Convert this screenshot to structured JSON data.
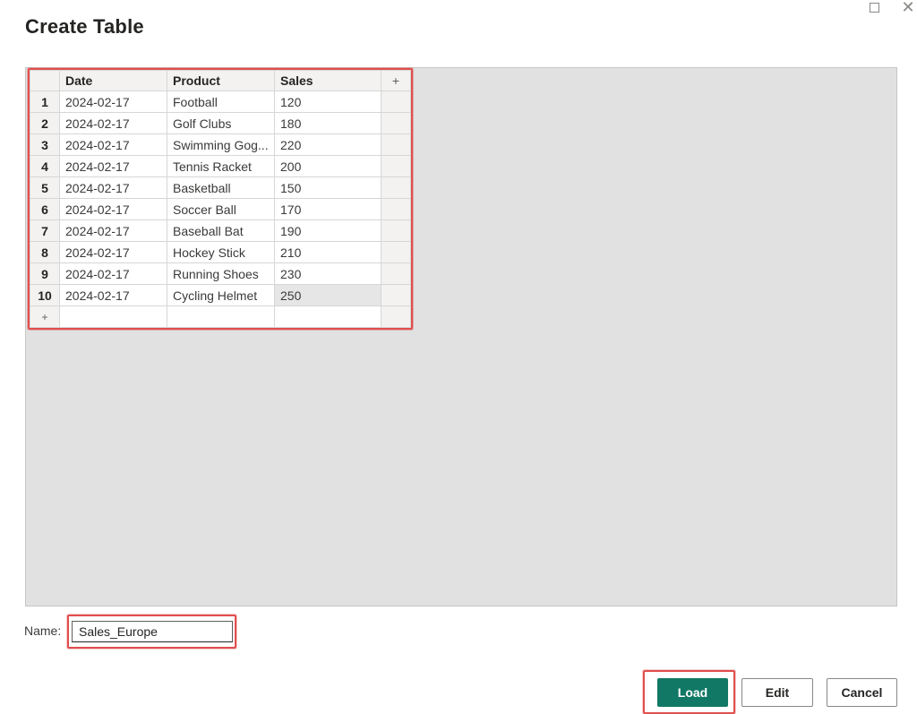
{
  "dialog": {
    "title": "Create Table",
    "maximize_icon": "maximize-icon",
    "close_icon": "close-icon",
    "close_glyph": "✕"
  },
  "table": {
    "columns": [
      "Date",
      "Product",
      "Sales"
    ],
    "add_column_label": "+",
    "add_row_label": "+",
    "rows": [
      {
        "num": "1",
        "date": "2024-02-17",
        "product": "Football",
        "sales": "120"
      },
      {
        "num": "2",
        "date": "2024-02-17",
        "product": "Golf Clubs",
        "sales": "180"
      },
      {
        "num": "3",
        "date": "2024-02-17",
        "product": "Swimming Gog...",
        "sales": "220"
      },
      {
        "num": "4",
        "date": "2024-02-17",
        "product": "Tennis Racket",
        "sales": "200"
      },
      {
        "num": "5",
        "date": "2024-02-17",
        "product": "Basketball",
        "sales": "150"
      },
      {
        "num": "6",
        "date": "2024-02-17",
        "product": "Soccer Ball",
        "sales": "170"
      },
      {
        "num": "7",
        "date": "2024-02-17",
        "product": "Baseball Bat",
        "sales": "190"
      },
      {
        "num": "8",
        "date": "2024-02-17",
        "product": "Hockey Stick",
        "sales": "210"
      },
      {
        "num": "9",
        "date": "2024-02-17",
        "product": "Running Shoes",
        "sales": "230"
      },
      {
        "num": "10",
        "date": "2024-02-17",
        "product": "Cycling Helmet",
        "sales": "250"
      }
    ]
  },
  "name_field": {
    "label": "Name:",
    "value": "Sales_Europe"
  },
  "buttons": {
    "load": "Load",
    "edit": "Edit",
    "cancel": "Cancel"
  },
  "colors": {
    "accent": "#117865",
    "highlight": "#e04f4f",
    "grid_background": "#e1e1e1"
  }
}
